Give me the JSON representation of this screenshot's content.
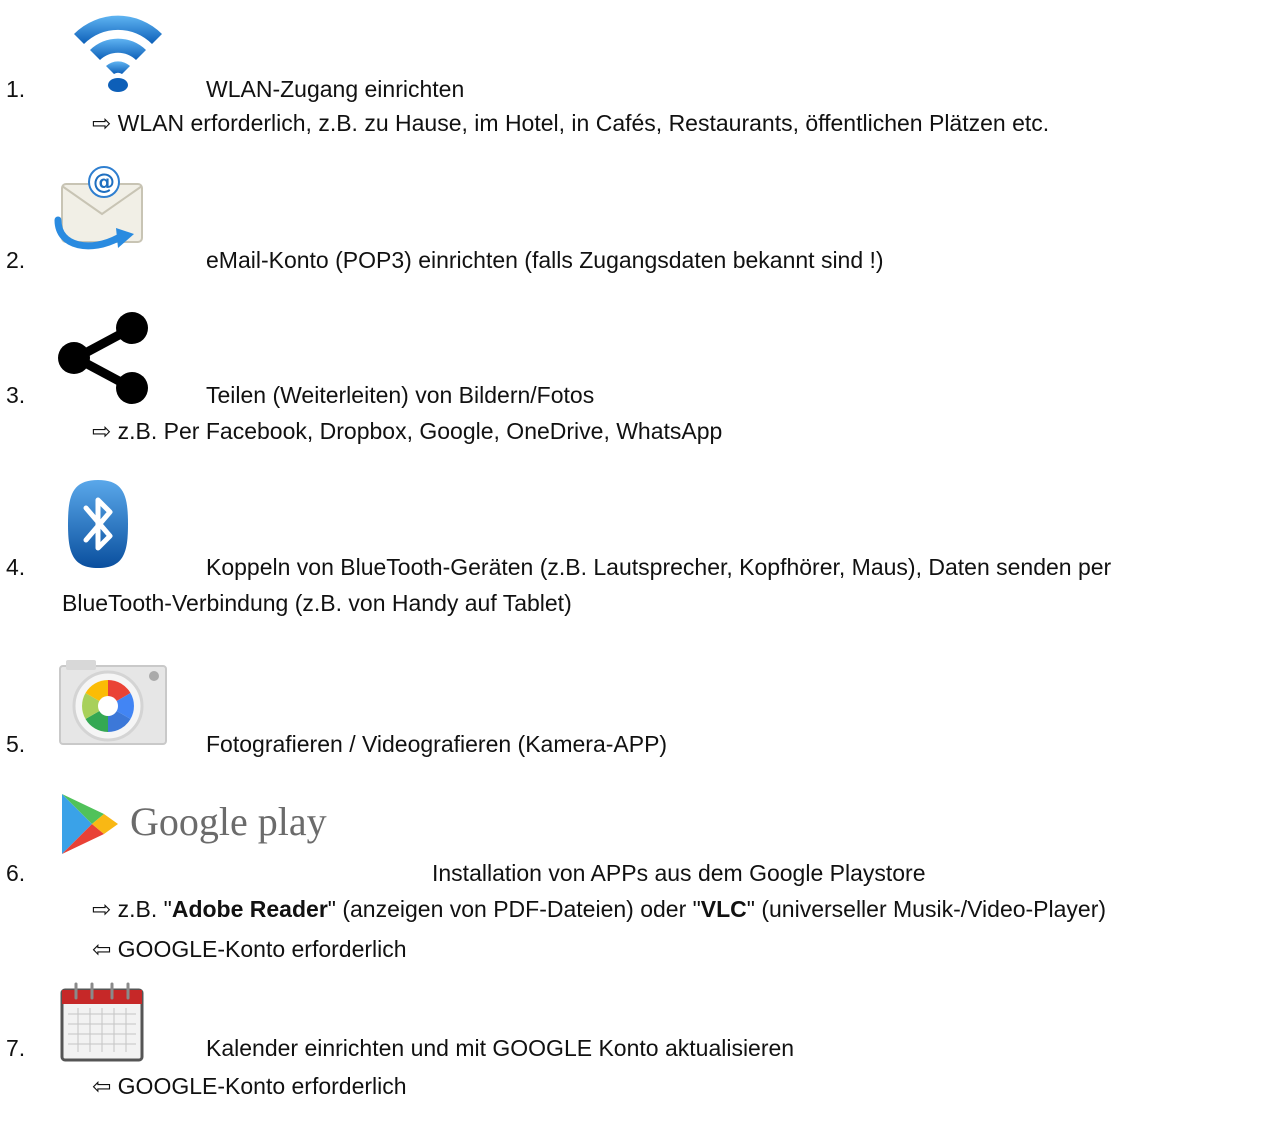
{
  "items": [
    {
      "num": "1.",
      "icon": "wifi-icon",
      "title": "WLAN-Zugang einrichten",
      "sub1": "⇨ WLAN erforderlich, z.B. zu Hause, im Hotel, in Cafés, Restaurants, öffentlichen Plätzen etc."
    },
    {
      "num": "2.",
      "icon": "email-icon",
      "title": "eMail-Konto (POP3) einrichten (falls Zugangsdaten bekannt sind !)"
    },
    {
      "num": "3.",
      "icon": "share-icon",
      "title": "Teilen (Weiterleiten) von Bildern/Fotos",
      "sub1": "⇨ z.B. Per Facebook, Dropbox, Google, OneDrive, WhatsApp"
    },
    {
      "num": "4.",
      "icon": "bluetooth-icon",
      "title": "Koppeln von BlueTooth-Geräten (z.B. Lautsprecher, Kopfhörer, Maus), Daten senden per",
      "title_cont": "BlueTooth-Verbindung (z.B. von Handy auf Tablet)"
    },
    {
      "num": "5.",
      "icon": "camera-icon",
      "title": "Fotografieren / Videografieren (Kamera-APP)"
    },
    {
      "num": "6.",
      "icon": "google-play-logo",
      "logo_text": "Google play",
      "title": "Installation von APPs aus dem Google Playstore",
      "sub1_pre": "⇨ z.B. \"",
      "sub1_b1": "Adobe Reader",
      "sub1_mid": "\" (anzeigen von PDF-Dateien) oder \"",
      "sub1_b2": "VLC",
      "sub1_post": "\" (universeller Musik-/Video-Player)",
      "sub2": "⇦ GOOGLE-Konto erforderlich"
    },
    {
      "num": "7.",
      "icon": "calendar-icon",
      "title": "Kalender einrichten und mit GOOGLE Konto aktualisieren",
      "sub1": "⇦ GOOGLE-Konto erforderlich"
    }
  ]
}
